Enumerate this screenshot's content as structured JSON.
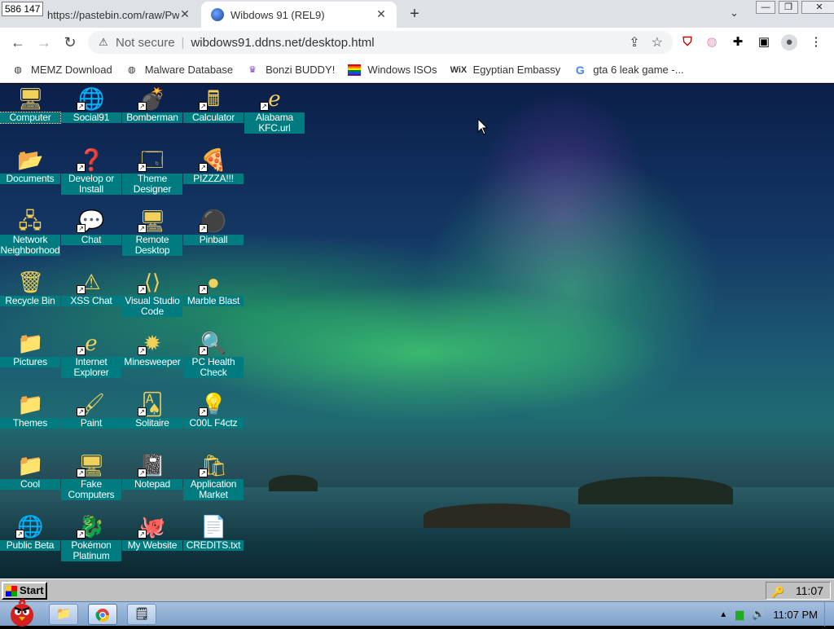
{
  "coords_readout": "586 147",
  "browser": {
    "tabs": [
      {
        "title": "https://pastebin.com/raw/PwHx",
        "close": "✕"
      },
      {
        "title": "Wibdows 91 (REL9)",
        "close": "✕"
      }
    ],
    "new_tab": "+",
    "tab_search": "⌄",
    "window_buttons": {
      "minimize": "—",
      "maximize": "❐",
      "close": "✕"
    },
    "security_label": "Not secure",
    "separator": "|",
    "url": "wibdows91.ddns.net/desktop.html",
    "bookmarks": [
      {
        "label": "MEMZ Download",
        "icon": "globe-icon"
      },
      {
        "label": "Malware Database",
        "icon": "globe-icon"
      },
      {
        "label": "Bonzi BUDDY!",
        "icon": "bonzi-icon"
      },
      {
        "label": "Windows ISOs",
        "icon": "rainbow-flag-icon"
      },
      {
        "label": "Egyptian Embassy",
        "icon": "wix-icon"
      },
      {
        "label": "gta 6 leak game -...",
        "icon": "google-icon"
      }
    ],
    "wix_text": "WiX",
    "google_text": "G"
  },
  "desktop": {
    "icons": [
      {
        "label": "Computer",
        "art": "🖥",
        "bg": "#c0c0c0",
        "shortcut": false,
        "selected": true
      },
      {
        "label": "Social91",
        "art": "🌐",
        "bg": "",
        "shortcut": true
      },
      {
        "label": "Bomberman",
        "art": "💣",
        "bg": "",
        "shortcut": true
      },
      {
        "label": "Calculator",
        "art": "🖩",
        "bg": "",
        "shortcut": true
      },
      {
        "label": "Alabama KFC.url",
        "art": "ℯ",
        "bg": "",
        "shortcut": true
      },
      {
        "label": "Documents",
        "art": "📂",
        "bg": "",
        "shortcut": false
      },
      {
        "label": "Develop or Install",
        "art": "❓",
        "bg": "",
        "shortcut": true
      },
      {
        "label": "Theme Designer",
        "art": "🗔",
        "bg": "",
        "shortcut": true
      },
      {
        "label": "PIZZZA!!!",
        "art": "🍕",
        "bg": "",
        "shortcut": true
      },
      {
        "label": "Network Neighborhood",
        "art": "🖧",
        "bg": "",
        "shortcut": false
      },
      {
        "label": "Chat",
        "art": "💬",
        "bg": "",
        "shortcut": true
      },
      {
        "label": "Remote Desktop",
        "art": "🖥",
        "bg": "",
        "shortcut": true
      },
      {
        "label": "Pinball",
        "art": "⚫",
        "bg": "",
        "shortcut": true
      },
      {
        "label": "Recycle Bin",
        "art": "🗑",
        "bg": "",
        "shortcut": false
      },
      {
        "label": "XSS Chat",
        "art": "⚠",
        "bg": "",
        "shortcut": true
      },
      {
        "label": "Visual Studio Code",
        "art": "⟨⟩",
        "bg": "",
        "shortcut": true
      },
      {
        "label": "Marble Blast",
        "art": "●",
        "bg": "",
        "shortcut": true
      },
      {
        "label": "Pictures",
        "art": "📁",
        "bg": "",
        "shortcut": false
      },
      {
        "label": "Internet Explorer",
        "art": "ℯ",
        "bg": "",
        "shortcut": true
      },
      {
        "label": "Minesweeper",
        "art": "✹",
        "bg": "",
        "shortcut": true
      },
      {
        "label": "PC Health Check",
        "art": "🔍",
        "bg": "",
        "shortcut": true
      },
      {
        "label": "Themes",
        "art": "📁",
        "bg": "",
        "shortcut": false
      },
      {
        "label": "Paint",
        "art": "🖌",
        "bg": "",
        "shortcut": true
      },
      {
        "label": "Solitaire",
        "art": "🂡",
        "bg": "",
        "shortcut": true
      },
      {
        "label": "C00L F4ctz",
        "art": "💡",
        "bg": "",
        "shortcut": true
      },
      {
        "label": "Cool",
        "art": "📁",
        "bg": "",
        "shortcut": false
      },
      {
        "label": "Fake Computers",
        "art": "🖥",
        "bg": "",
        "shortcut": true
      },
      {
        "label": "Notepad",
        "art": "📓",
        "bg": "",
        "shortcut": true
      },
      {
        "label": "Application Market",
        "art": "🛍",
        "bg": "",
        "shortcut": true
      },
      {
        "label": "Public Beta",
        "art": "🌐",
        "bg": "",
        "shortcut": true
      },
      {
        "label": "Pokémon Platinum",
        "art": "🐉",
        "bg": "",
        "shortcut": true
      },
      {
        "label": "My Website",
        "art": "🐙",
        "bg": "",
        "shortcut": true
      },
      {
        "label": "CREDITS.txt",
        "art": "📄",
        "bg": "",
        "shortcut": false
      }
    ],
    "shortcut_glyph": "↗"
  },
  "w91_taskbar": {
    "start_label": "Start",
    "tray_icon": "🔑",
    "clock": "11:07"
  },
  "host_taskbar": {
    "tray_arrow": "▲",
    "network_icon": "▆",
    "volume_icon": "🔊",
    "clock": "11:07 PM"
  }
}
